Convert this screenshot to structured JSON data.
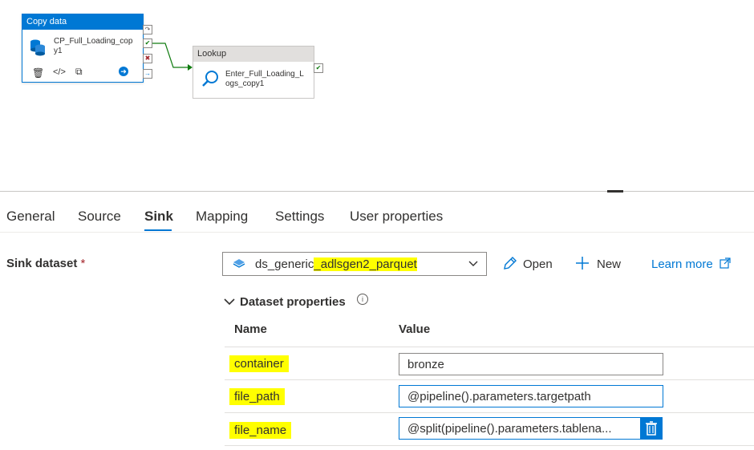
{
  "pipeline": {
    "copy_activity": {
      "type_label": "Copy data",
      "name": "CP_Full_Loading_copy1"
    },
    "lookup_activity": {
      "type_label": "Lookup",
      "name": "Enter_Full_Loading_Logs_copy1"
    }
  },
  "tabs": [
    "General",
    "Source",
    "Sink",
    "Mapping",
    "Settings",
    "User properties"
  ],
  "active_tab": "Sink",
  "sink": {
    "label": "Sink dataset",
    "required_marker": "*",
    "dataset_prefix": "ds_generic",
    "dataset_highlight": "_adlsgen2_parquet",
    "open_label": "Open",
    "new_label": "New",
    "learn_more_label": "Learn more"
  },
  "dataset_properties": {
    "title": "Dataset properties",
    "col_name": "Name",
    "col_value": "Value",
    "rows": [
      {
        "name": "container",
        "value": "bronze"
      },
      {
        "name": "file_path",
        "value": "@pipeline().parameters.targetpath"
      },
      {
        "name": "file_name",
        "value": "@split(pipeline().parameters.tablena..."
      }
    ]
  },
  "colors": {
    "accent": "#0078d4",
    "highlight": "#ffff00",
    "success": "#107c10",
    "error": "#a4262c"
  }
}
